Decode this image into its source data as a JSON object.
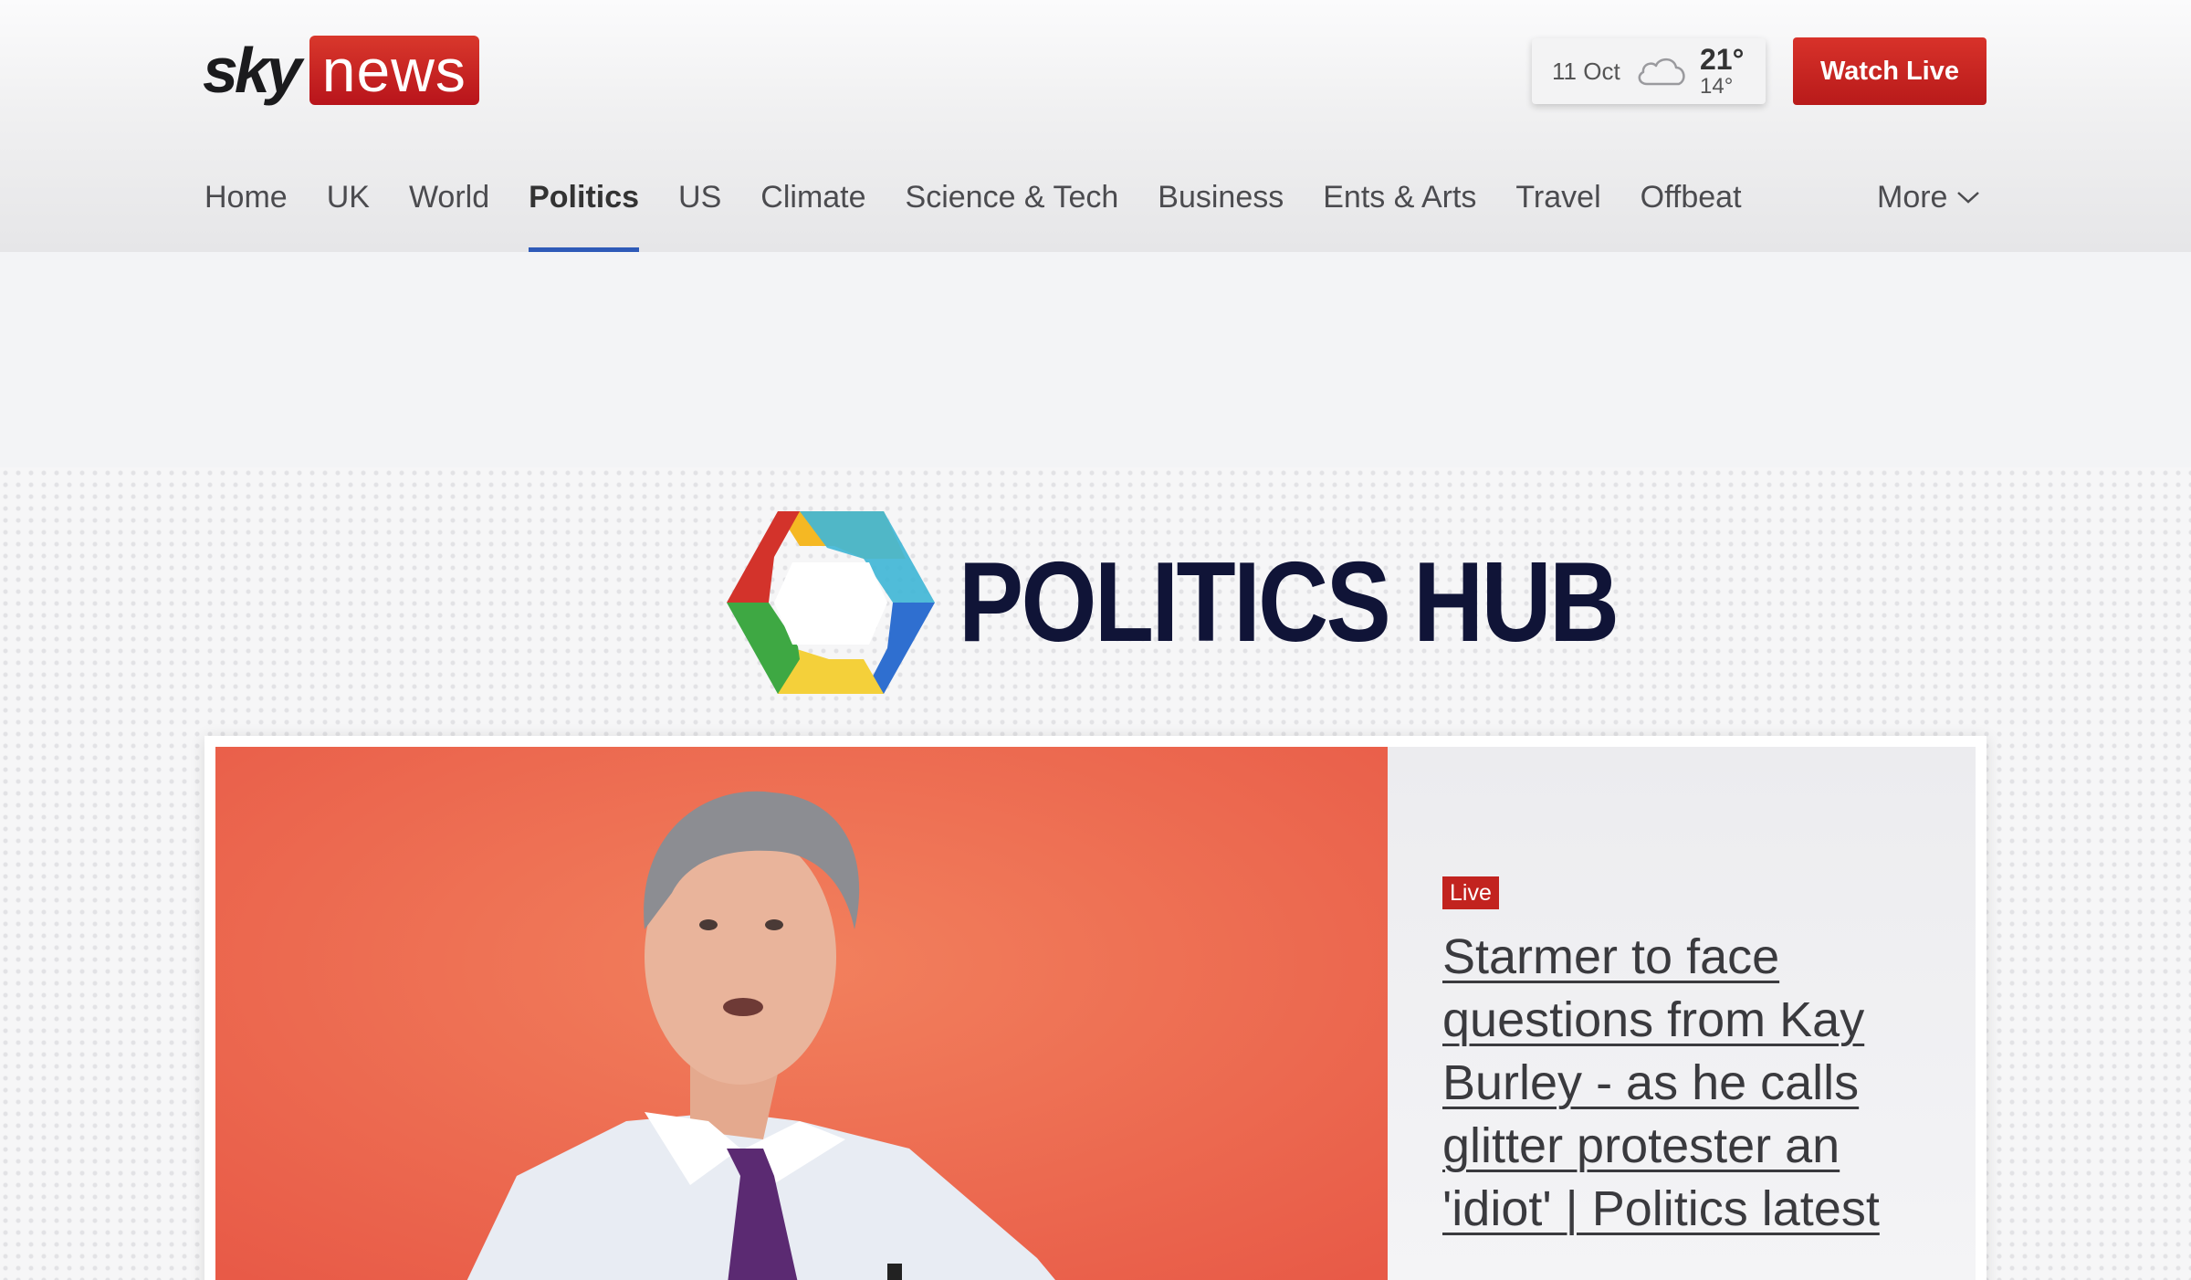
{
  "header": {
    "logo_sky": "sky",
    "logo_news": "news",
    "weather": {
      "date": "11 Oct",
      "icon": "cloud-icon",
      "high": "21°",
      "low": "14°"
    },
    "watch_live_label": "Watch Live"
  },
  "nav": {
    "items": [
      {
        "label": "Home",
        "active": false
      },
      {
        "label": "UK",
        "active": false
      },
      {
        "label": "World",
        "active": false
      },
      {
        "label": "Politics",
        "active": true
      },
      {
        "label": "US",
        "active": false
      },
      {
        "label": "Climate",
        "active": false
      },
      {
        "label": "Science & Tech",
        "active": false
      },
      {
        "label": "Business",
        "active": false
      },
      {
        "label": "Ents & Arts",
        "active": false
      },
      {
        "label": "Travel",
        "active": false
      },
      {
        "label": "Offbeat",
        "active": false
      }
    ],
    "more_label": "More"
  },
  "hub": {
    "title": "POLITICS HUB"
  },
  "featured": {
    "badge": "Live",
    "headline": "Starmer to face questions from Kay Burley - as he calls glitter protester an 'idiot' | Politics latest"
  },
  "colors": {
    "brand_red": "#c2231f",
    "nav_active_underline": "#2e5ab8",
    "hub_title": "#101437"
  }
}
